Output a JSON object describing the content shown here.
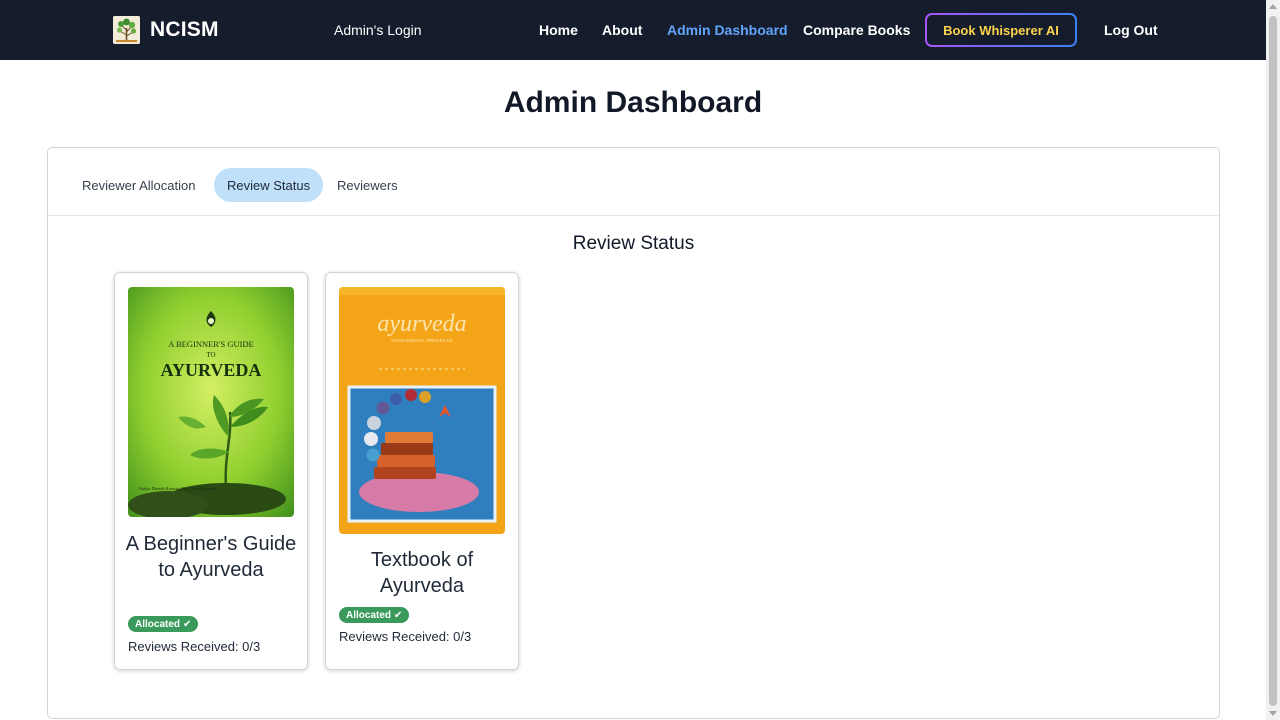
{
  "navbar": {
    "brand": "NCISM",
    "admin_login": "Admin's Login",
    "links": [
      {
        "label": "Home"
      },
      {
        "label": "About"
      },
      {
        "label": "Admin Dashboard"
      },
      {
        "label": "Compare Books"
      }
    ],
    "ai_button": "Book Whisperer AI",
    "logout": "Log Out",
    "accent_color": "#60a5fa",
    "ai_text_color": "#fcd34d"
  },
  "page": {
    "title": "Admin Dashboard"
  },
  "tabs": [
    {
      "label": "Reviewer Allocation",
      "active": false
    },
    {
      "label": "Review Status",
      "active": true
    },
    {
      "label": "Reviewers",
      "active": false
    }
  ],
  "section": {
    "title": "Review Status"
  },
  "books": [
    {
      "title": "A Beginner's Guide to Ayurveda",
      "badge": "Allocated",
      "badge_color": "#3a9a5c",
      "reviews": "Reviews Received: 0/3",
      "cover": {
        "line1": "A BEGINNER'S GUIDE",
        "line2": "TO",
        "line3": "AYURVEDA",
        "authors": "Vaidya Dinesh Kataria / Prof. Mita Kotecha"
      }
    },
    {
      "title": "Textbook of Ayurveda",
      "badge": "Allocated",
      "badge_color": "#3a9a5c",
      "reviews": "Reviews Received: 0/3",
      "cover": {
        "line1": "ayurveda",
        "line2": "FUNDAMENTAL PRINCIPLES"
      }
    }
  ]
}
